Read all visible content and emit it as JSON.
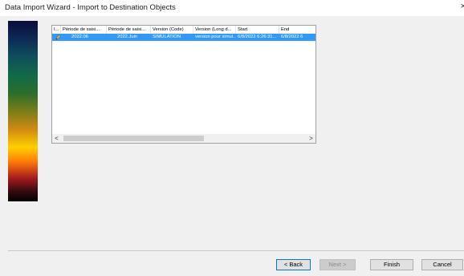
{
  "window": {
    "title": "Data Import Wizard - Import to Destination Objects",
    "close_glyph": "×"
  },
  "table": {
    "columns": [
      "I...",
      "Période de saisi...",
      "Période de saisi...",
      "Version (Code)",
      "Version (Long d...",
      "Start",
      "End"
    ],
    "rows": [
      {
        "icon": "pencil-icon",
        "selected": true,
        "cells": [
          "",
          "2022.06",
          "2022.Juin",
          "SIMULATION",
          "version pour simul...",
          "6/8/2022 6:26:31...",
          "6/8/2022 6"
        ]
      }
    ],
    "scroll_left": "<",
    "scroll_right": ">"
  },
  "buttons": {
    "back": "< Back",
    "next": "Next >",
    "finish": "Finish",
    "cancel": "Cancel"
  },
  "colors": {
    "selection": "#3399ff",
    "background": "#f0f0f0"
  }
}
